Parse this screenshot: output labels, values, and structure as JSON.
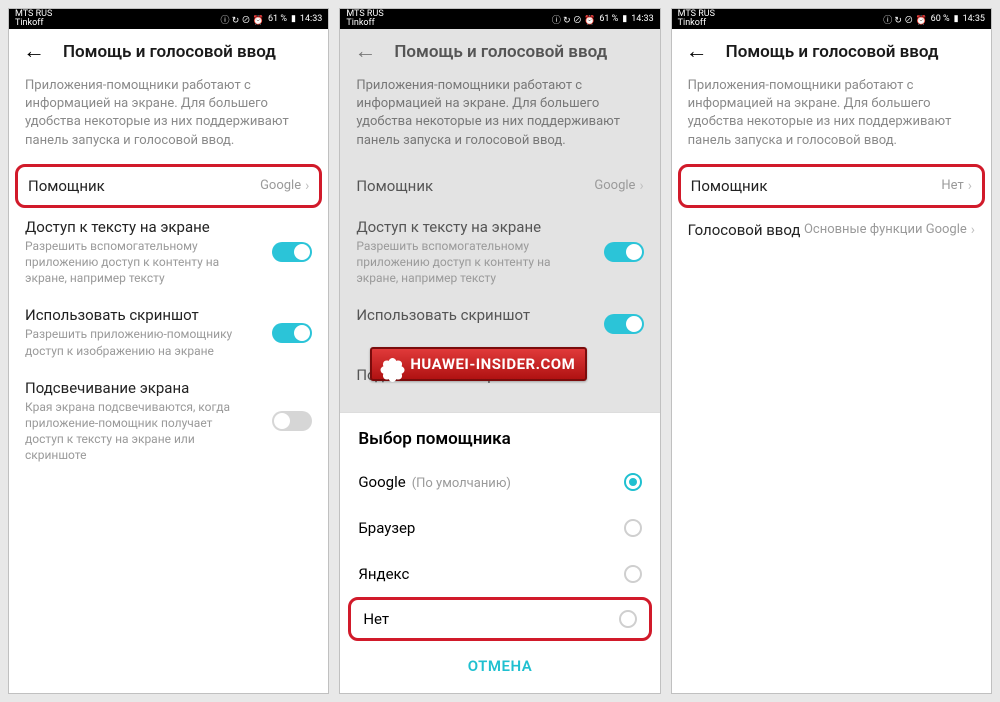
{
  "statusbar": {
    "carrier1": "MTS RUS",
    "carrier2": "Tinkoff",
    "icons": "ⓘ ↻ ⊘ ⏰",
    "battery1": "61 %",
    "battery3": "60 %",
    "time1": "14:33",
    "time3": "14:35"
  },
  "header": {
    "title": "Помощь и голосовой ввод"
  },
  "desc": "Приложения-помощники работают с информацией на экране. Для большего удобства некоторые из них поддерживают панель запуска и голосовой ввод.",
  "screen1": {
    "assistant": {
      "label": "Помощник",
      "value": "Google"
    },
    "textAccess": {
      "label": "Доступ к тексту на экране",
      "sub": "Разрешить вспомогательному приложению доступ к контенту на экране, например тексту",
      "on": true
    },
    "screenshot": {
      "label": "Использовать скриншот",
      "sub": "Разрешить приложению-помощнику доступ к изображению на экране",
      "on": true
    },
    "highlight": {
      "label": "Подсвечивание экрана",
      "sub": "Края экрана подсвечиваются, когда приложение-помощник получает доступ к тексту на экране или скриншоте",
      "on": false
    }
  },
  "screen2": {
    "sheetTitle": "Выбор помощника",
    "options": [
      {
        "label": "Google",
        "default": "(По умолчанию)",
        "selected": true
      },
      {
        "label": "Браузер",
        "selected": false
      },
      {
        "label": "Яндекс",
        "selected": false
      },
      {
        "label": "Нет",
        "selected": false,
        "highlighted": true
      }
    ],
    "cancel": "ОТМЕНА",
    "watermark": "HUAWEI-INSIDER.COM"
  },
  "screen3": {
    "assistant": {
      "label": "Помощник",
      "value": "Нет"
    },
    "voiceInput": {
      "label": "Голосовой ввод",
      "value": "Основные функции Google"
    }
  }
}
